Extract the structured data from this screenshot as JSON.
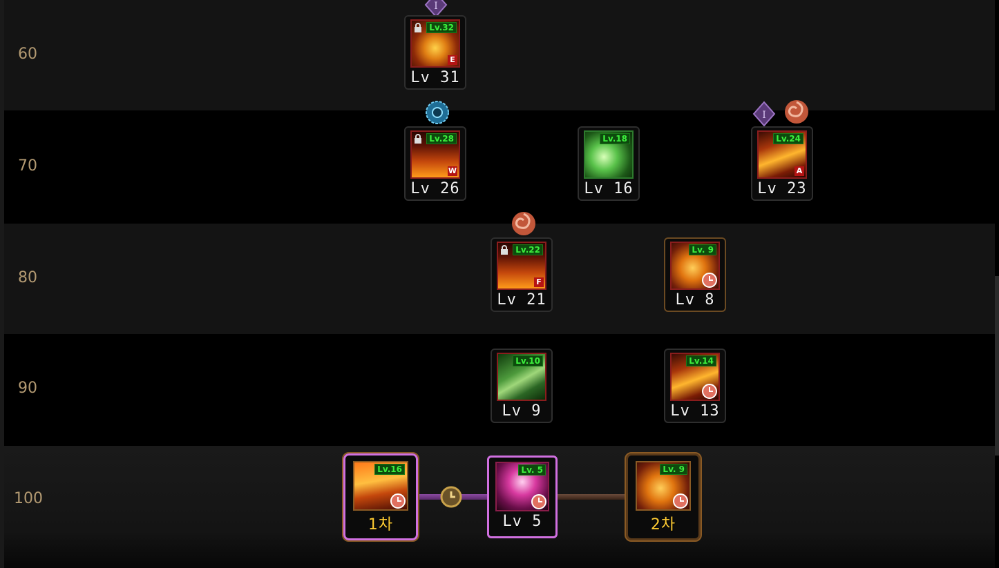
{
  "levels": [
    "60",
    "70",
    "80",
    "90",
    "100"
  ],
  "skills": {
    "r60_a": {
      "label": "Lv 31",
      "badge": "Lv.32",
      "elem": "E"
    },
    "r70_a": {
      "label": "Lv 26",
      "badge": "Lv.28",
      "elem": "W"
    },
    "r70_b": {
      "label": "Lv 16",
      "badge": "Lv.18"
    },
    "r70_c": {
      "label": "Lv 23",
      "badge": "Lv.24",
      "elem": "A"
    },
    "r80_a": {
      "label": "Lv 21",
      "badge": "Lv.22",
      "elem": "F"
    },
    "r80_b": {
      "label": "Lv 8",
      "badge": "Lv. 9"
    },
    "r90_a": {
      "label": "Lv 9",
      "badge": "Lv.10"
    },
    "r90_b": {
      "label": "Lv 13",
      "badge": "Lv.14"
    },
    "r100_a": {
      "label": "1차",
      "badge": "Lv.16"
    },
    "r100_b": {
      "label": "Lv 5",
      "badge": "Lv. 5"
    },
    "r100_c": {
      "label": "2차",
      "badge": "Lv. 9"
    }
  },
  "marks": {
    "tier_roman": "I"
  },
  "colors": {
    "level_text": "#b39a72",
    "badge_green": "#3df03d",
    "gold_label": "#ffcc33",
    "frame_pink": "#d070e0",
    "frame_gold": "#8a5a24"
  }
}
